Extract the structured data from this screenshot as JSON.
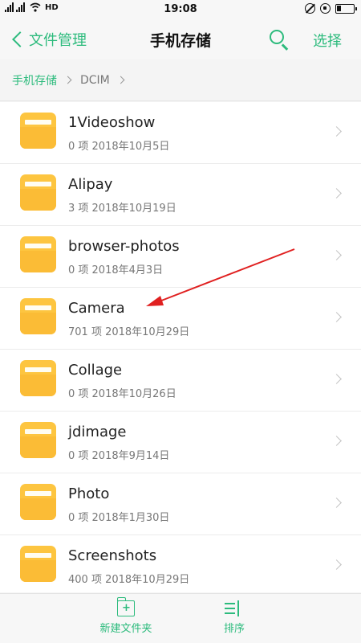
{
  "status_bar": {
    "time": "19:08",
    "signal1_tag": "4G",
    "signal2_tag": "2G",
    "call_tag": "HD"
  },
  "header": {
    "back_label": "文件管理",
    "title": "手机存储",
    "select_label": "选择"
  },
  "breadcrumb": {
    "root": "手机存储",
    "current": "DCIM"
  },
  "files": [
    {
      "name": "1Videoshow",
      "meta": "0 项  2018年10月5日"
    },
    {
      "name": "Alipay",
      "meta": "3 项  2018年10月19日"
    },
    {
      "name": "browser-photos",
      "meta": "0 项  2018年4月3日"
    },
    {
      "name": "Camera",
      "meta": "701 项  2018年10月29日"
    },
    {
      "name": "Collage",
      "meta": "0 项  2018年10月26日"
    },
    {
      "name": "jdimage",
      "meta": "0 项  2018年9月14日"
    },
    {
      "name": "Photo",
      "meta": "0 项  2018年1月30日"
    },
    {
      "name": "Screenshots",
      "meta": "400 项  2018年10月29日"
    }
  ],
  "toolbar": {
    "new_folder_label": "新建文件夹",
    "sort_label": "排序"
  },
  "colors": {
    "accent": "#2dbb7d",
    "folder": "#fdc540",
    "annotation_arrow": "#e02020"
  }
}
